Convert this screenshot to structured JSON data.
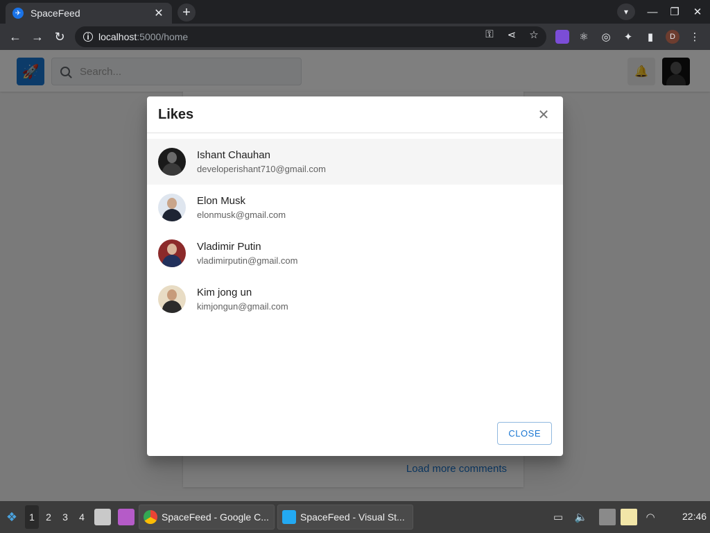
{
  "browser": {
    "tab_title": "SpaceFeed",
    "tab_close": "✕",
    "new_tab": "+",
    "url_host": "localhost",
    "url_path": ":5000/home",
    "profile_initial": "D"
  },
  "app": {
    "search_placeholder": "Search...",
    "load_more": "Load more comments"
  },
  "modal": {
    "title": "Likes",
    "close_label": "CLOSE",
    "users": [
      {
        "name": "Ishant Chauhan",
        "email": "developerishant710@gmail.com"
      },
      {
        "name": "Elon Musk",
        "email": "elonmusk@gmail.com"
      },
      {
        "name": "Vladimir Putin",
        "email": "vladimirputin@gmail.com"
      },
      {
        "name": "Kim jong un",
        "email": "kimjongun@gmail.com"
      }
    ]
  },
  "taskbar": {
    "workspaces": [
      "1",
      "2",
      "3",
      "4"
    ],
    "tasks": [
      "SpaceFeed - Google C...",
      "SpaceFeed - Visual St..."
    ],
    "clock": "22:46"
  },
  "colors": {
    "accent": "#1976d2",
    "chrome_dark": "#202124",
    "chrome_toolbar": "#35363a",
    "backdrop": "rgba(0,0,0,0.5)"
  }
}
